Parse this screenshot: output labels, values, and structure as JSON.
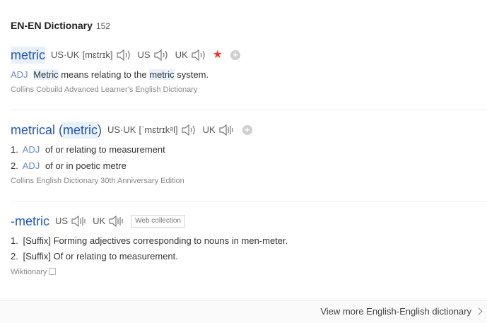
{
  "header": {
    "title": "EN-EN Dictionary",
    "count": "152"
  },
  "entries": [
    {
      "word": "metric",
      "pron": [
        {
          "label": "US·UK",
          "phonetic": "[mɛtrɪk]"
        },
        {
          "label": "US"
        },
        {
          "label": "UK"
        }
      ],
      "definitions": [
        {
          "pos": "ADJ",
          "parts": [
            "Metric",
            " means relating to the ",
            "metric",
            " system."
          ]
        }
      ],
      "source": "Collins Cobuild Advanced Learner's English Dictionary"
    },
    {
      "word_prefix": "metrical ( ",
      "word_core": "metric",
      "word_suffix": " )",
      "pron": [
        {
          "label": "US·UK",
          "phonetic": "[ˈmɛtrɪkᵊl]"
        },
        {
          "label": "UK"
        }
      ],
      "definitions": [
        {
          "num": "1.",
          "pos": "ADJ",
          "text": "of or relating to measurement"
        },
        {
          "num": "2.",
          "pos": "ADJ",
          "text": "of or in poetic metre"
        }
      ],
      "source": "Collins English Dictionary 30th Anniversary Edition"
    },
    {
      "word": "-metric",
      "pron": [
        {
          "label": "US"
        },
        {
          "label": "UK"
        }
      ],
      "tag": "Web collection",
      "definitions": [
        {
          "num": "1.",
          "text": "[Suffix] Forming adjectives corresponding to nouns in men-meter."
        },
        {
          "num": "2.",
          "text": "[Suffix] Of or relating to measurement."
        }
      ],
      "source": "Wiktionary"
    }
  ],
  "footer": {
    "view_more": "View more English-English dictionary"
  },
  "icons": {
    "speaker": "speaker-icon",
    "favorite": "star-icon",
    "add": "plus-icon",
    "external": "external-link-icon",
    "chevron": "chevron-right-icon"
  },
  "colors": {
    "headword": "#2456b3",
    "pos": "#6a8ab8",
    "star": "#e53b33",
    "highlight": "#e8f0fb"
  }
}
